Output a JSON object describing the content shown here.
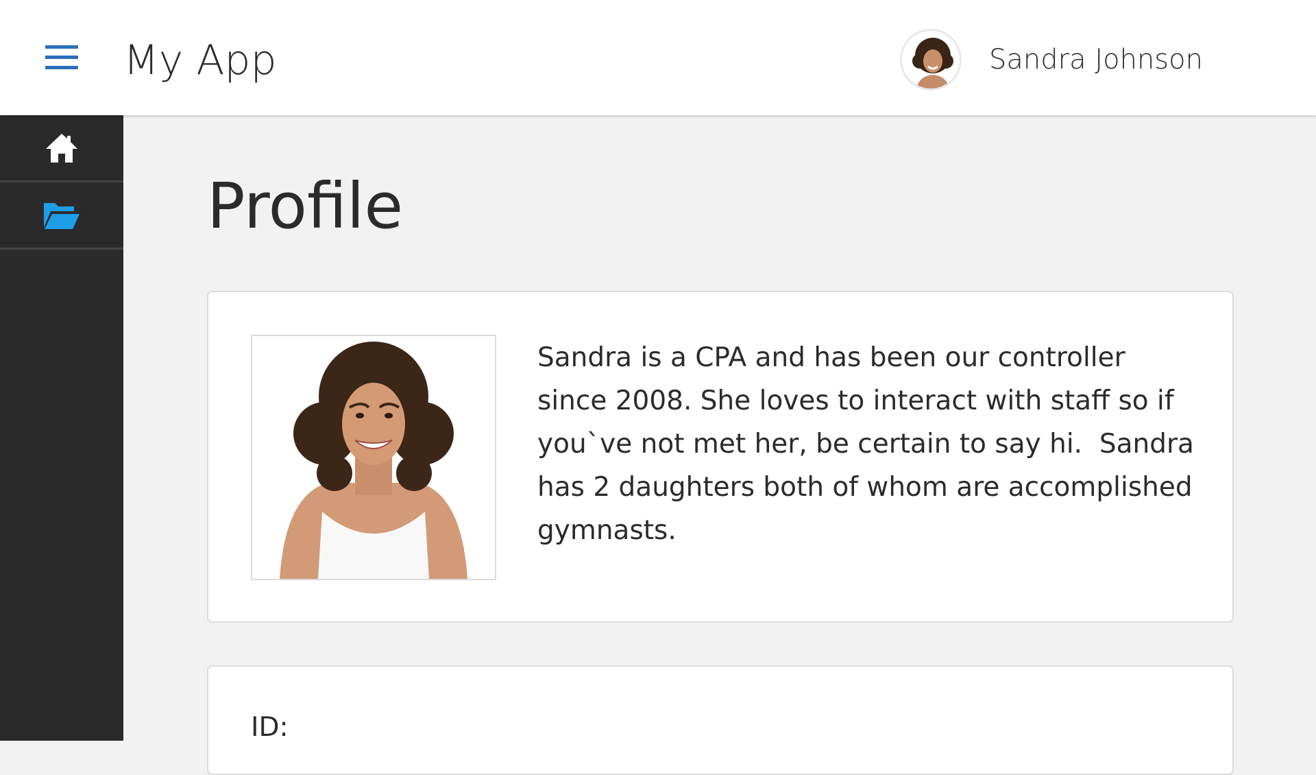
{
  "header": {
    "app_title": "My App",
    "user_name": "Sandra Johnson",
    "menu_icon": "hamburger-menu-icon",
    "accent_color": "#2a6fba"
  },
  "sidebar": {
    "items": [
      {
        "icon": "home-icon",
        "active": false
      },
      {
        "icon": "folder-open-icon",
        "active": true,
        "color": "#1e9de8"
      }
    ]
  },
  "main": {
    "page_title": "Profile",
    "profile_card": {
      "bio": "Sandra is a CPA and has been our controller since 2008. She loves to interact with staff so if you`ve not met her, be certain to say hi.  Sandra has 2 daughters both of whom are accomplished gymnasts."
    },
    "details_card": {
      "id_label": "ID:"
    }
  }
}
